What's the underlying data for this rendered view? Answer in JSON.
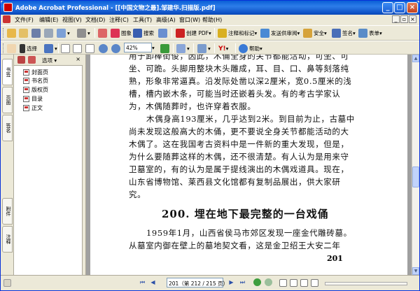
{
  "window": {
    "title": "Adobe Acrobat Professional - [[中国文物之最].邹建华.扫描版.pdf]"
  },
  "menu": [
    "文件(F)",
    "编辑(E)",
    "视图(V)",
    "文档(D)",
    "注释(C)",
    "工具(T)",
    "高级(A)",
    "窗口(W)",
    "帮助(H)"
  ],
  "toolbar1": {
    "search": "搜索",
    "create_pdf": "创建 PDF",
    "comment": "注释和标记",
    "send_review": "发送供审阅",
    "security": "安全",
    "sign": "签名",
    "forms": "表单"
  },
  "toolbar2": {
    "select": "选择",
    "zoom_value": "42%",
    "help": "帮助"
  },
  "sidebar": {
    "tabs": [
      "书签",
      "页面",
      "签名",
      "附件",
      "注释"
    ]
  },
  "bookmarks": {
    "options": "选项",
    "items": [
      "封面页",
      "书名页",
      "版权页",
      "目录",
      "正文"
    ]
  },
  "page": {
    "lines": [
      "用于卸棒街俊，因此，木俑全身的关节都能活动，可坐、可",
      "坐、可跪。头脚用整块木头雕成，耳、目、口、鼻等刻落纯",
      "熟，形象非常逼真。沿发际处凿以深2厘米，宽0.5厘米的浅",
      "槽，槽内嵌木条，可能当时还嵌着头发。有的考古学家认",
      "为，木偶随葬时，也许穿着衣服。",
      "木偶身高193厘米，几乎达到2米。到目前为止，古墓中",
      "尚未发现这般高大的木俑，更不要说全身关节都能活动的大",
      "木偶了。这在我国考古资料中是一件新的重大发现，但是，",
      "为什么要随葬这样的木偶，还不很清楚。有人认为是用来守",
      "卫墓室的，有的认为是属于提线演出的木偶戏道具。现在，",
      "山东省博物馆、莱西县文化馆都有复制品展出，供大家研",
      "究。"
    ],
    "heading": "200. 埋在地下最完整的一台戏俑",
    "lines2": [
      "1959年1月，山西省侯马市郊区发现一座金代雕砖墓。",
      "从墓室内御在壁上的墓地契文看，这是金卫绍王大安二年"
    ],
    "page_number": "201"
  },
  "status": {
    "page_display": "201（第 212 / 215 页）"
  }
}
